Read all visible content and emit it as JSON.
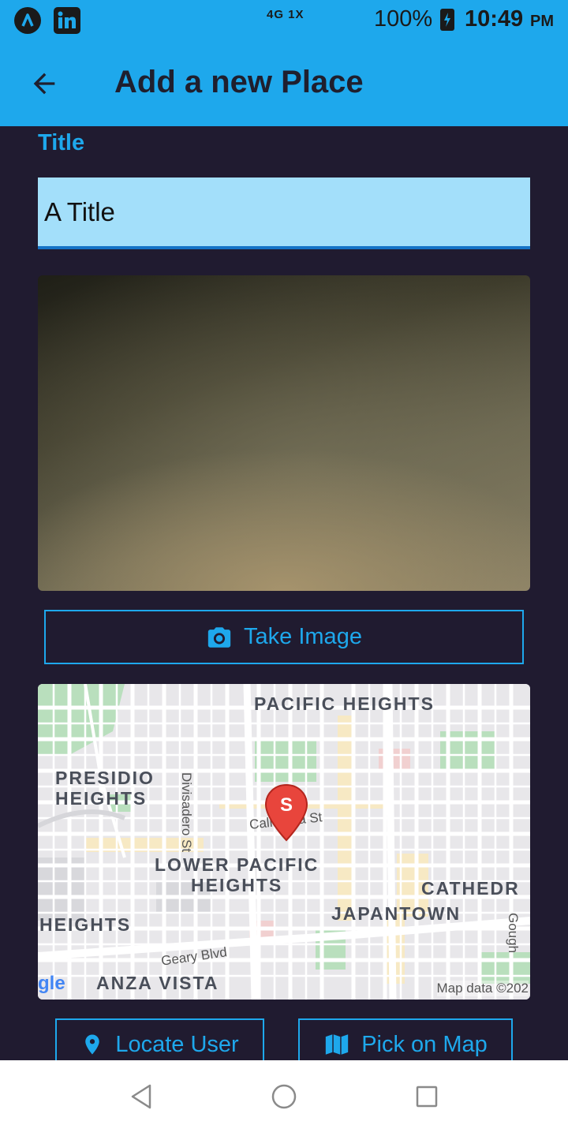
{
  "status_bar": {
    "network_text": "4G 1X",
    "battery": "100%",
    "time": "10:49",
    "ampm": "PM",
    "app_icons": [
      "app-a-icon",
      "linkedin-icon"
    ]
  },
  "app_bar": {
    "title": "Add a new Place",
    "back_icon": "arrow-back-icon",
    "color": "#1ea8ec"
  },
  "form": {
    "title_label": "Title",
    "title_value": "A Title"
  },
  "take_image_button": {
    "label": "Take Image",
    "icon": "camera-icon"
  },
  "map": {
    "labels": {
      "pacific_heights": "PACIFIC HEIGHTS",
      "presidio_heights": "PRESIDIO\nHEIGHTS",
      "lower_pacific_heights": "LOWER PACIFIC\nHEIGHTS",
      "cathedral": "CATHEDR",
      "japantown": "JAPANTOWN",
      "heights": "HEIGHTS",
      "anza_vista": "ANZA VISTA"
    },
    "streets": {
      "divisadero": "Divisadero St",
      "california": "California St",
      "geary": "Geary Blvd",
      "gough": "Gough"
    },
    "marker_letter": "S",
    "credit": "Map data ©202",
    "logo": "gle"
  },
  "locate_button": {
    "label": "Locate User",
    "icon": "location-pin-icon"
  },
  "pick_map_button": {
    "label": "Pick on Map",
    "icon": "map-icon"
  },
  "accent_color": "#1ea8ec"
}
